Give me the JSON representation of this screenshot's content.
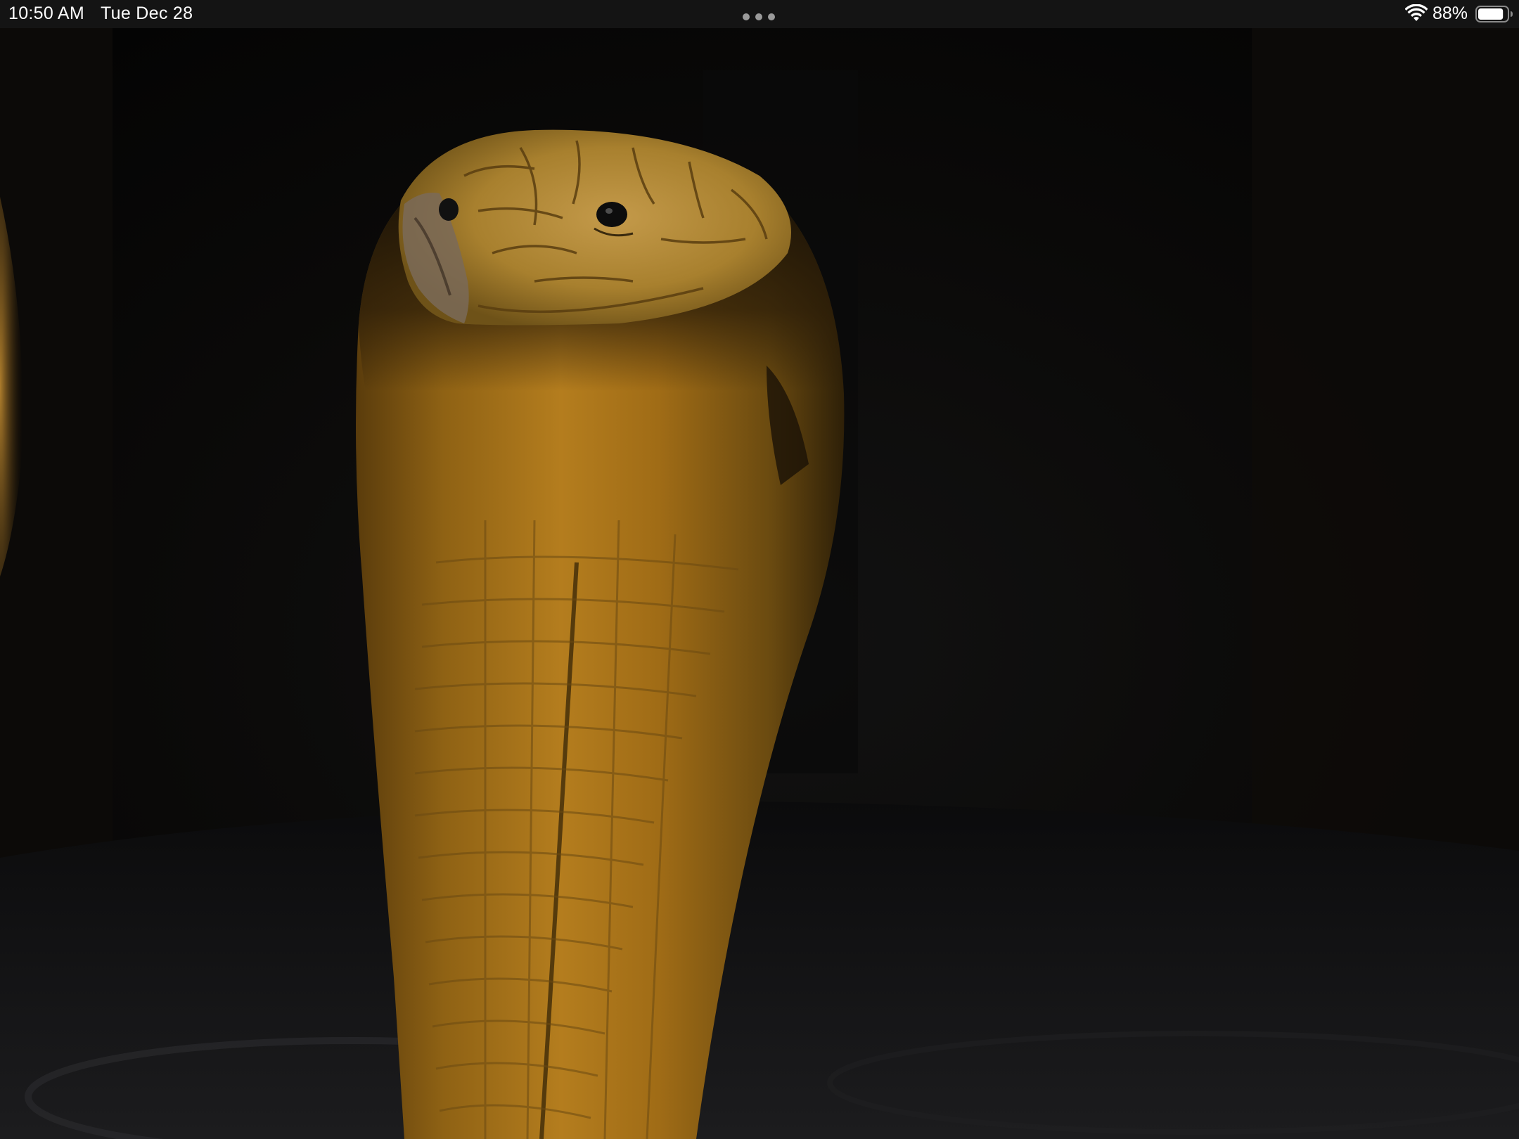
{
  "status_bar": {
    "time": "10:50 AM",
    "date": "Tue Dec 28",
    "battery_percent": "88%",
    "battery_level": 0.88,
    "wifi_icon": "wifi-icon",
    "battery_icon": "battery-icon",
    "multitask_icon": "multitasking-dots-icon"
  },
  "content": {
    "subject": "cobra",
    "colors": {
      "background": "#050505",
      "status_bar": "#141414",
      "snake_body": "#a87418",
      "snake_head": "#b88a3c",
      "snake_shadow": "#2a1c08"
    }
  }
}
